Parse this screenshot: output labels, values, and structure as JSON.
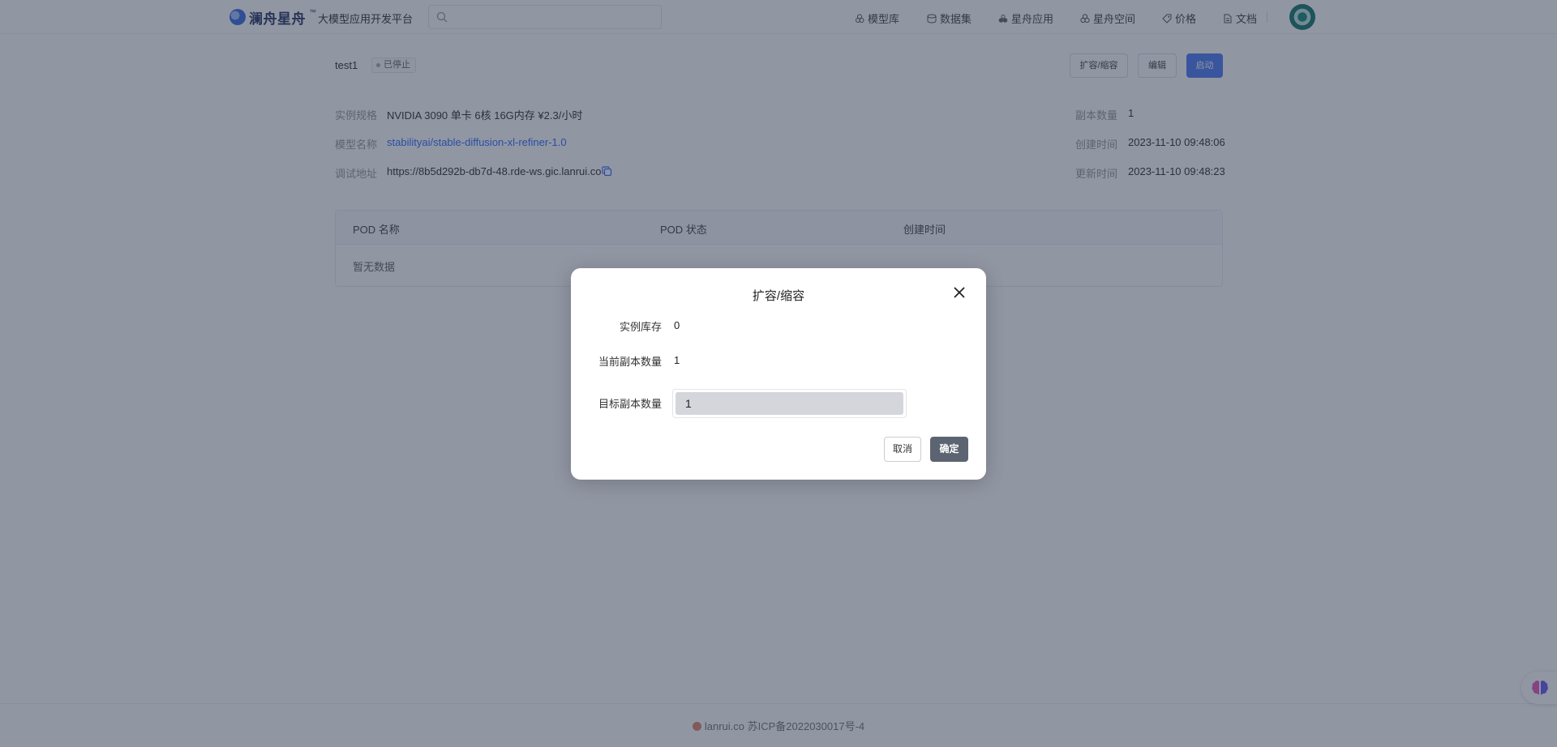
{
  "header": {
    "brand": "澜舟星舟",
    "brand_tm": "™",
    "platform": "大模型应用开发平台",
    "search_placeholder": "",
    "nav": [
      {
        "label": "模型库",
        "icon": "model-library-icon"
      },
      {
        "label": "数据集",
        "icon": "dataset-icon"
      },
      {
        "label": "星舟应用",
        "icon": "app-icon"
      },
      {
        "label": "星舟空间",
        "icon": "space-icon"
      },
      {
        "label": "价格",
        "icon": "price-icon"
      },
      {
        "label": "文档",
        "icon": "document-icon"
      }
    ]
  },
  "instance": {
    "name": "test1",
    "status": "已停止",
    "actions": {
      "scale": "扩容/缩容",
      "edit": "编辑",
      "start": "启动"
    },
    "info_left": [
      {
        "label": "实例规格",
        "value": "NVIDIA 3090 单卡 6核 16G内存 ¥2.3/小时"
      },
      {
        "label": "模型名称",
        "value": "stabilityai/stable-diffusion-xl-refiner-1.0"
      },
      {
        "label": "调试地址",
        "value": "https://8b5d292b-db7d-48.rde-ws.gic.lanrui.co"
      }
    ],
    "info_right": [
      {
        "label": "副本数量",
        "value": "1"
      },
      {
        "label": "创建时间",
        "value": "2023-11-10 09:48:06"
      },
      {
        "label": "更新时间",
        "value": "2023-11-10 09:48:23"
      }
    ]
  },
  "pod_table": {
    "columns": [
      "POD 名称",
      "POD 状态",
      "创建时间"
    ],
    "empty_text": "暂无数据"
  },
  "footer": {
    "text": "lanrui.co 苏ICP备2022030017号-4"
  },
  "modal": {
    "title": "扩容/缩容",
    "fields": {
      "stock_label": "实例库存",
      "stock_value": "0",
      "current_label": "当前副本数量",
      "current_value": "1",
      "target_label": "目标副本数量",
      "target_value": "1"
    },
    "cancel": "取消",
    "confirm": "确定"
  },
  "colors": {
    "accent": "#4f7cf5",
    "link": "#2f6fff",
    "overlay": "#232d48",
    "confirm_button": "#5c6472"
  }
}
